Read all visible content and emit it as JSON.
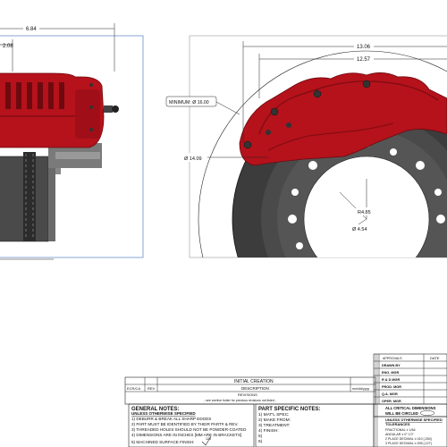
{
  "left_view": {
    "dim_top": "6.84",
    "dim_sub": "2.08"
  },
  "right_view": {
    "dim_outer": "13.06",
    "dim_inner": "12.57",
    "min_label": "MINIMUM: Ø 16.00",
    "dia_left": "Ø 14.09",
    "radius": "R4.85",
    "dia_center": "Ø 4.54"
  },
  "revisions": {
    "initial": "INITIAL CREATION",
    "col_ecr": "ECR/CA",
    "col_rev": "REV",
    "col_desc": "DESCRIPTION",
    "col_date": "mm/dd/yyyy",
    "title": "REVISIONS",
    "note": "- see archive folder for previous revisions not listed -"
  },
  "general_notes": {
    "title": "GENERAL NOTES:",
    "subtitle": "UNLESS OTHERWISE SPECIFIED",
    "items": [
      "1) DEBURR & BREAK ALL SHARP EDGES",
      "2) PART MUST BE IDENTIFIED BY THEIR PART# & REV.",
      "3) THREADED HOLES SHOULD NOT BE POWDER-COATED",
      "4) DIMENSIONS ARE IN INCHES [MM ARE IN BRACKETS]",
      "5) MACHINED SURFACE FINISH: "
    ],
    "finish_value": "125"
  },
  "part_notes": {
    "title": "PART SPECIFIC NOTES:",
    "items": [
      "1) MAT'L SPEC:",
      "2) MAKE FROM:",
      "3) TREATMENT:",
      "4) FINISH:",
      "5)",
      "6)"
    ]
  },
  "approvals": {
    "header_approvals": "APPROVALS",
    "header_date": "DATE",
    "roles": [
      "DRAWN BY",
      "ENG. MGR",
      "R & D MGR",
      "PROD. MGR",
      "Q.A. MGR",
      "OPER. MGR"
    ]
  },
  "critical": {
    "line1": "ALL CRITICAL DIMENSIONS",
    "line2": "WILL BE CIRCLED"
  },
  "tolerances": {
    "title": "UNLESS OTHERWISE SPECIFIED",
    "subtitle": "TOLERANCES",
    "rows": [
      "FRACTIONAL ± 1/64",
      "ANGULAR ± 0° 1'0\"",
      "2 PLACE DECIMAL ±.010 [.254]",
      "3 PLACE DECIMAL ±.005 [.127]"
    ]
  },
  "colors": {
    "caliper_red": "#b5121b",
    "caliper_dark": "#6d0a0f",
    "rotor_dark": "#3a3a3a",
    "rotor_mid": "#5a5a5a",
    "frame_blue": "#6a8fc8"
  }
}
